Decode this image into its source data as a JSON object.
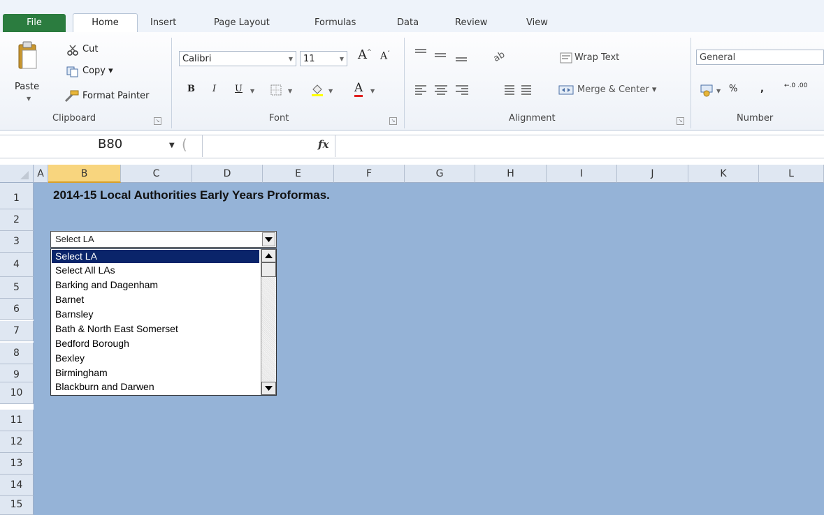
{
  "tabs": {
    "file": "File",
    "home": "Home",
    "insert": "Insert",
    "page_layout": "Page Layout",
    "formulas": "Formulas",
    "data": "Data",
    "review": "Review",
    "view": "View"
  },
  "clipboard": {
    "paste": "Paste",
    "cut": "Cut",
    "copy": "Copy ▾",
    "format_painter": "Format Painter",
    "label": "Clipboard"
  },
  "font": {
    "name": "Calibri",
    "size": "11",
    "label": "Font",
    "bold": "B",
    "italic": "I",
    "underline": "U",
    "grow": "A",
    "shrink": "A",
    "color": "A"
  },
  "alignment": {
    "wrap_text": "Wrap Text",
    "merge_center": "Merge & Center ▾",
    "label": "Alignment"
  },
  "number": {
    "format": "General",
    "label": "Number",
    "percent": "%",
    "comma": ",",
    "decimal": "←.0 .00"
  },
  "formula_bar": {
    "name_box": "B80",
    "fx": "fx",
    "value": ""
  },
  "columns": [
    "A",
    "B",
    "C",
    "D",
    "E",
    "F",
    "G",
    "H",
    "I",
    "J",
    "K",
    "L"
  ],
  "selected_column": "B",
  "rows": [
    "1",
    "2",
    "3",
    "4",
    "5",
    "6",
    "7",
    "8",
    "9",
    "10",
    "11",
    "12",
    "13",
    "14",
    "15"
  ],
  "sheet": {
    "title": "2014-15 Local Authorities Early Years Proformas.",
    "background": "#95b3d7"
  },
  "combo": {
    "value": "Select LA",
    "options": [
      "Select LA",
      "Select All LAs",
      "Barking and Dagenham",
      "Barnet",
      "Barnsley",
      "Bath & North East Somerset",
      "Bedford Borough",
      "Bexley",
      "Birmingham",
      "Blackburn and Darwen"
    ],
    "selected_index": 0
  }
}
